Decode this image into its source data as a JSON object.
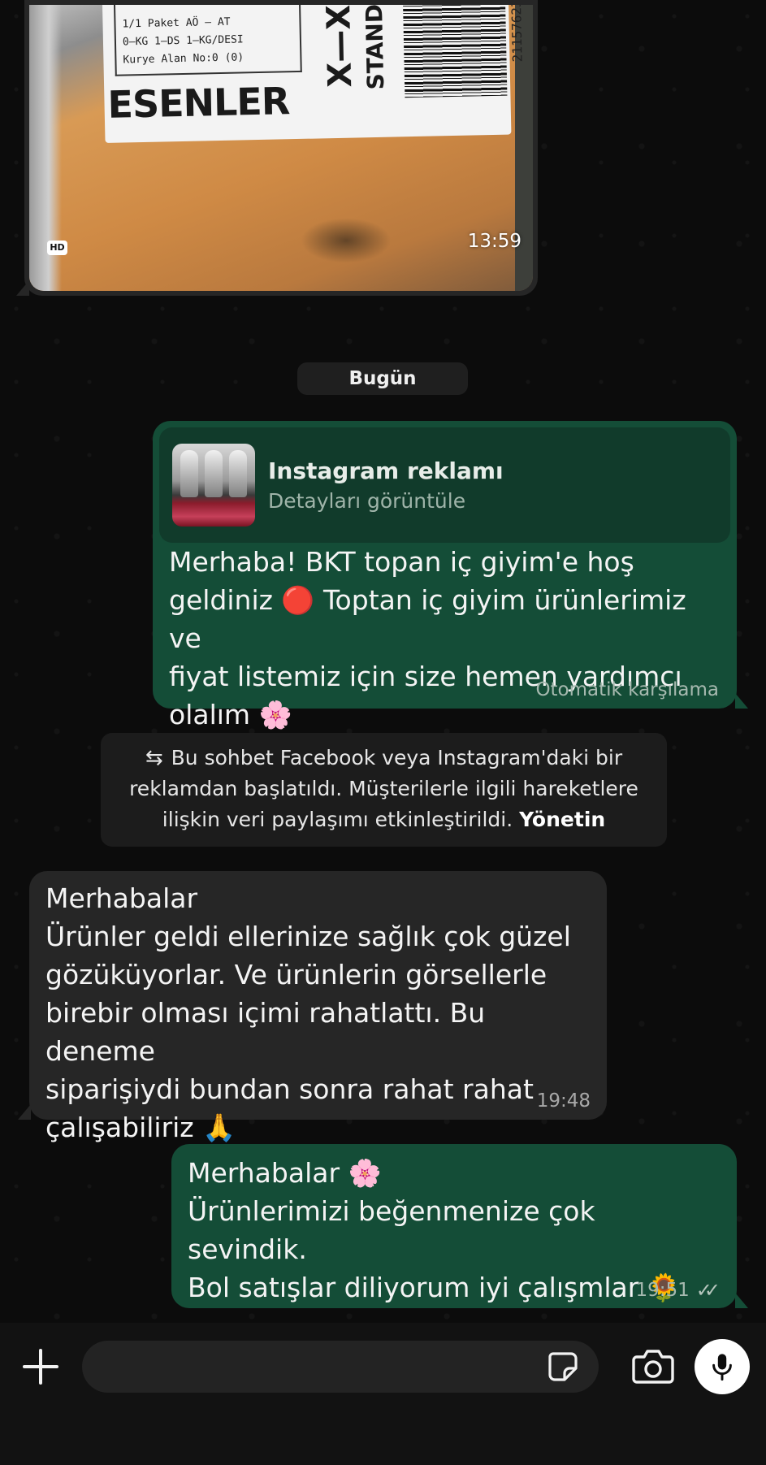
{
  "photo_message": {
    "label_lines": [
      "1/1 Paket AÖ  —  AT",
      "0—KG 1—DS 1—KG/DESI",
      "Kurye Alan No:0 (0)"
    ],
    "label_city": "ESENLER",
    "label_mark": "X—X",
    "label_stand": "STAND",
    "barcode_number": "21157623",
    "hd_badge": "HD",
    "time": "13:59"
  },
  "date_separator": "Bugün",
  "ad_message": {
    "ad_title": "Instagram reklamı",
    "ad_subtitle": "Detayları görüntüle",
    "text": "Merhaba! BKT topan iç giyim'e hoş\ngeldiniz 🔴 Toptan iç giyim ürünlerimiz ve\nfiyat listemiz için size hemen yardımcı\nolalım 🌸",
    "footer": "Otomatik karşılama"
  },
  "system_notice": {
    "icon": "⇆",
    "text": "Bu sohbet Facebook veya Instagram'daki bir reklamdan başlatıldı. Müşterilerle ilgili hareketlere ilişkin veri paylaşımı etkinleştirildi.",
    "action": "Yönetin"
  },
  "incoming_message": {
    "text": "Merhabalar\nÜrünler geldi ellerinize sağlık çok güzel\ngözüküyorlar. Ve ürünlerin görsellerle\nbirebir olması içimi rahatlattı. Bu deneme\nsiparişiydi bundan sonra rahat rahat\nçalışabiliriz 🙏",
    "time": "19:48"
  },
  "reply_message": {
    "text": "Merhabalar 🌸\nÜrünlerimizi beğenmenize çok sevindik.\nBol satışlar diliyorum iyi çalışmlar 🌻",
    "time": "19:51",
    "ticks": "✓✓"
  },
  "composer": {
    "input_value": "",
    "input_placeholder": ""
  },
  "colors": {
    "outgoing_bubble": "#144d37",
    "incoming_bubble": "#262626",
    "background": "#0c0c0c"
  }
}
